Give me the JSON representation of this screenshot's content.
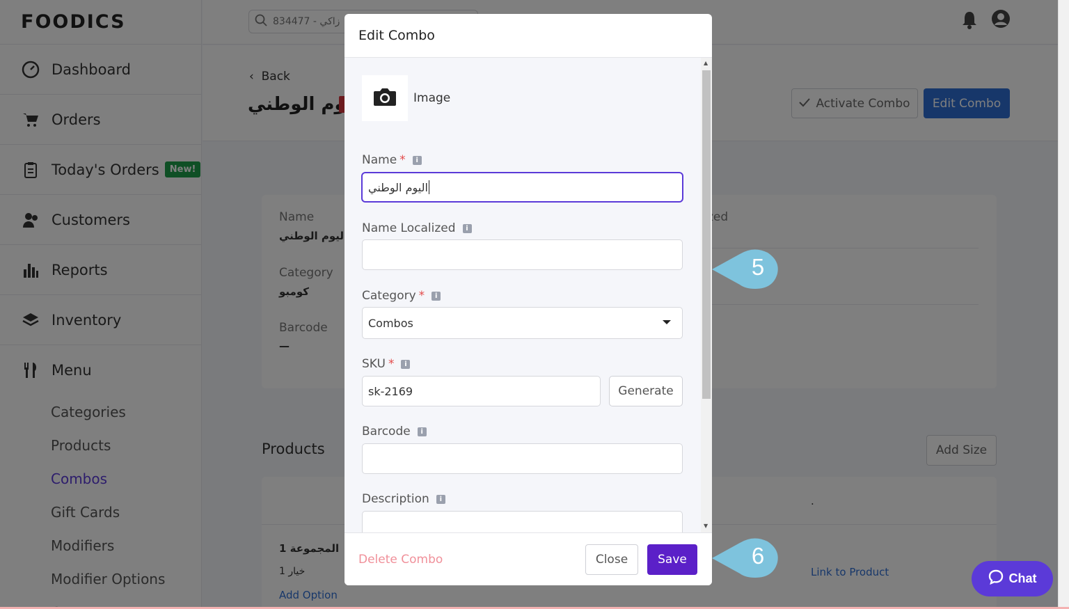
{
  "brand": {
    "logo_text": "FOODICS"
  },
  "topbar": {
    "search_value": "834477 - زاكي"
  },
  "sidebar": {
    "items": [
      {
        "label": "Dashboard",
        "icon": "dashboard-icon"
      },
      {
        "label": "Orders",
        "icon": "cart-icon"
      },
      {
        "label": "Today's Orders",
        "icon": "clipboard-icon",
        "badge": "New!"
      },
      {
        "label": "Customers",
        "icon": "customers-icon"
      },
      {
        "label": "Reports",
        "icon": "bar-chart-icon"
      },
      {
        "label": "Inventory",
        "icon": "layers-icon"
      },
      {
        "label": "Menu",
        "icon": "utensils-icon"
      }
    ],
    "menu_subitems": [
      "Categories",
      "Products",
      "Combos",
      "Gift Cards",
      "Modifiers",
      "Modifier Options",
      "Groups"
    ],
    "active_subitem": "Combos"
  },
  "page": {
    "back_label": "Back",
    "title": "اليوم الوطني",
    "activate_button": "Activate Combo",
    "edit_button": "Edit Combo",
    "info": {
      "name_label": "Name",
      "name_value": "اليوم الوطني",
      "category_label": "Category",
      "category_value": "كومبو",
      "barcode_label": "Barcode",
      "barcode_value": "—",
      "name_localized_partial": "zed"
    },
    "products_title": "Products",
    "add_size_button": "Add Size",
    "products_header_dot": ".",
    "group_name": "المجموعة 1",
    "option_name": "خيار 1",
    "add_option": "Add Option",
    "link_to_product": "Link to Product"
  },
  "modal": {
    "title": "Edit Combo",
    "image_label": "Image",
    "fields": {
      "name_label": "Name",
      "name_value": "اليوم الوطني",
      "name_localized_label": "Name Localized",
      "name_localized_value": "",
      "category_label": "Category",
      "category_value": "Combos",
      "sku_label": "SKU",
      "sku_value": "sk-2169",
      "generate_button": "Generate",
      "barcode_label": "Barcode",
      "barcode_value": "",
      "description_label": "Description",
      "description_value": ""
    },
    "required_mark": "*",
    "info_mark": "i",
    "delete_label": "Delete Combo",
    "close_label": "Close",
    "save_label": "Save"
  },
  "callouts": {
    "first": "5",
    "second": "6"
  },
  "chat": {
    "label": "Chat"
  },
  "colors": {
    "primary_purple": "#5b20c8",
    "edit_blue": "#2f6fd4",
    "callout_blue": "#7ec3dd",
    "new_badge_green": "#1e9e4a",
    "delete_pink": "#f0909a"
  }
}
